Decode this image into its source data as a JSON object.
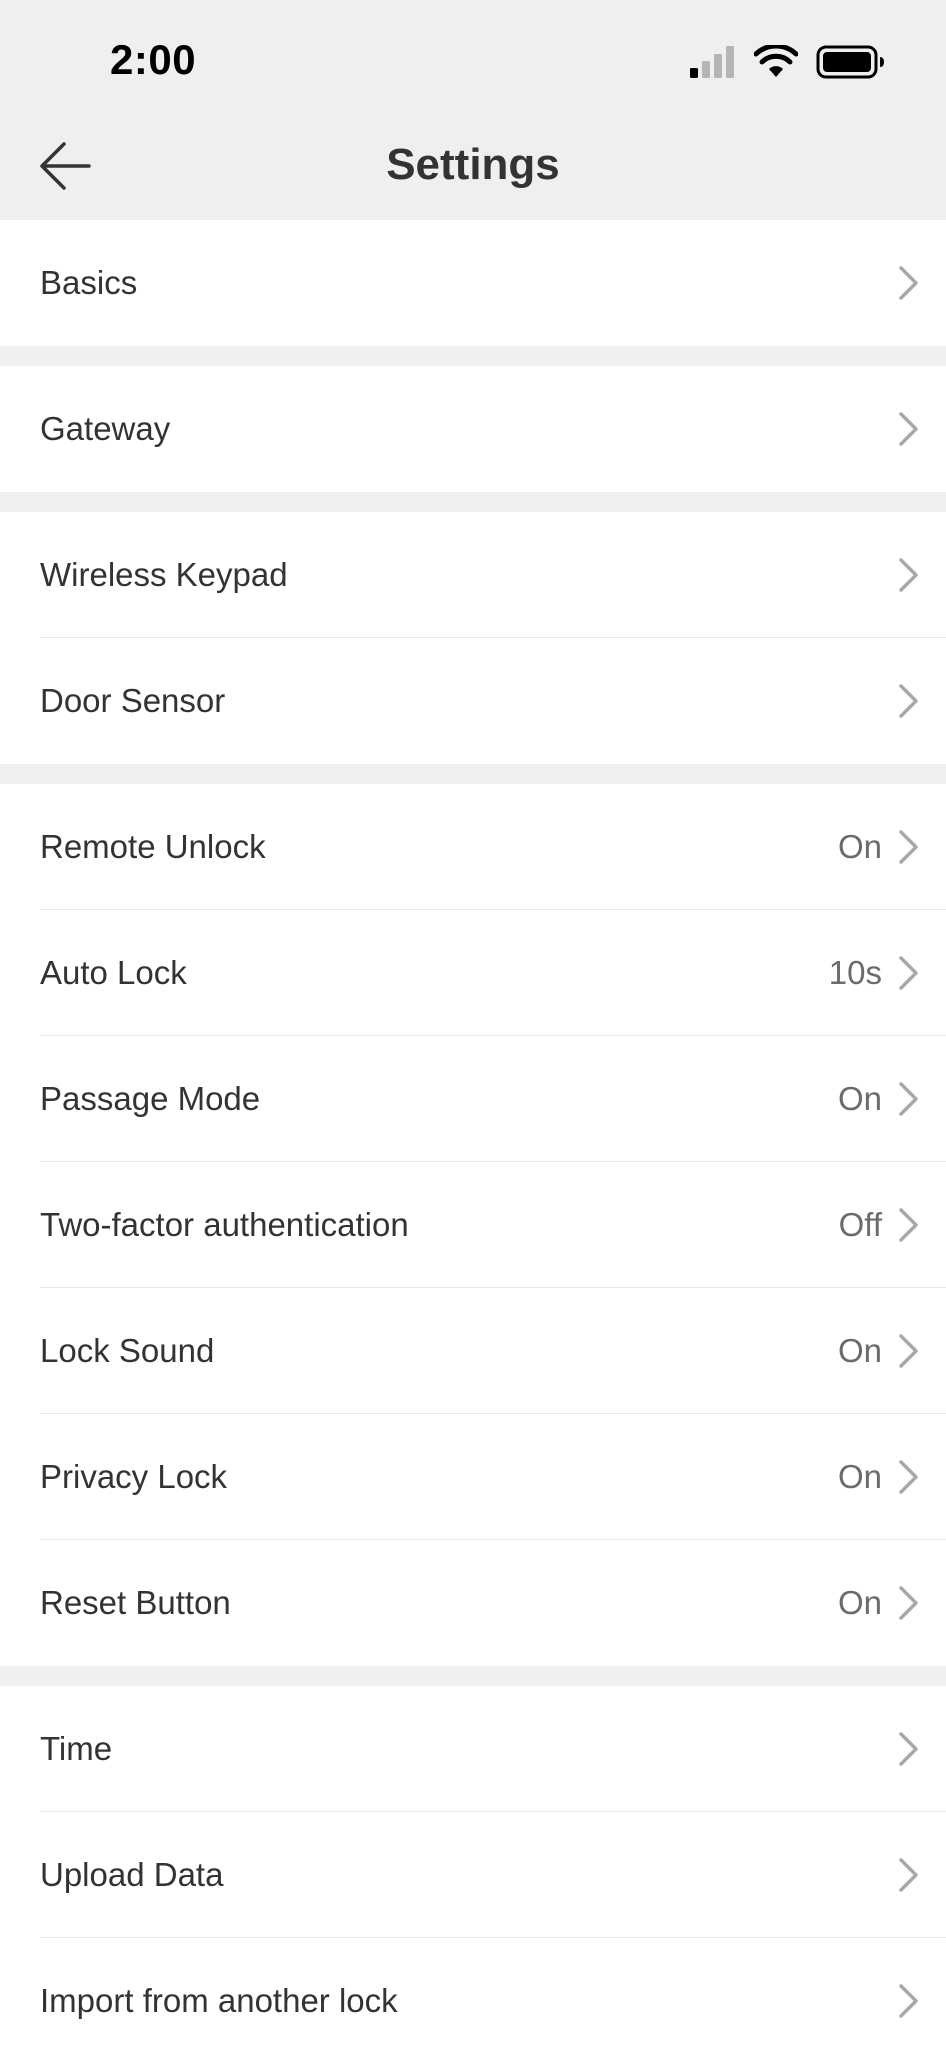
{
  "status_bar": {
    "time": "2:00"
  },
  "header": {
    "title": "Settings"
  },
  "groups": [
    {
      "items": [
        {
          "label": "Basics",
          "value": ""
        }
      ]
    },
    {
      "items": [
        {
          "label": "Gateway",
          "value": ""
        }
      ]
    },
    {
      "items": [
        {
          "label": "Wireless Keypad",
          "value": ""
        },
        {
          "label": "Door Sensor",
          "value": ""
        }
      ]
    },
    {
      "items": [
        {
          "label": "Remote Unlock",
          "value": "On"
        },
        {
          "label": "Auto Lock",
          "value": "10s"
        },
        {
          "label": "Passage Mode",
          "value": "On"
        },
        {
          "label": "Two-factor authentication",
          "value": "Off"
        },
        {
          "label": "Lock Sound",
          "value": "On"
        },
        {
          "label": "Privacy Lock",
          "value": "On"
        },
        {
          "label": "Reset Button",
          "value": "On"
        }
      ]
    },
    {
      "items": [
        {
          "label": "Time",
          "value": ""
        },
        {
          "label": "Upload Data",
          "value": ""
        },
        {
          "label": "Import from another lock",
          "value": ""
        }
      ]
    }
  ],
  "icons": {
    "back": "arrow-left-icon",
    "chevron": "chevron-right-icon",
    "signal": "cellular-signal-icon",
    "wifi": "wifi-icon",
    "battery": "battery-icon"
  },
  "colors": {
    "background": "#efeff1",
    "row_background": "#ffffff",
    "text": "#333333",
    "secondary_text": "#6b6b6b",
    "chevron": "#a8a8a8"
  }
}
